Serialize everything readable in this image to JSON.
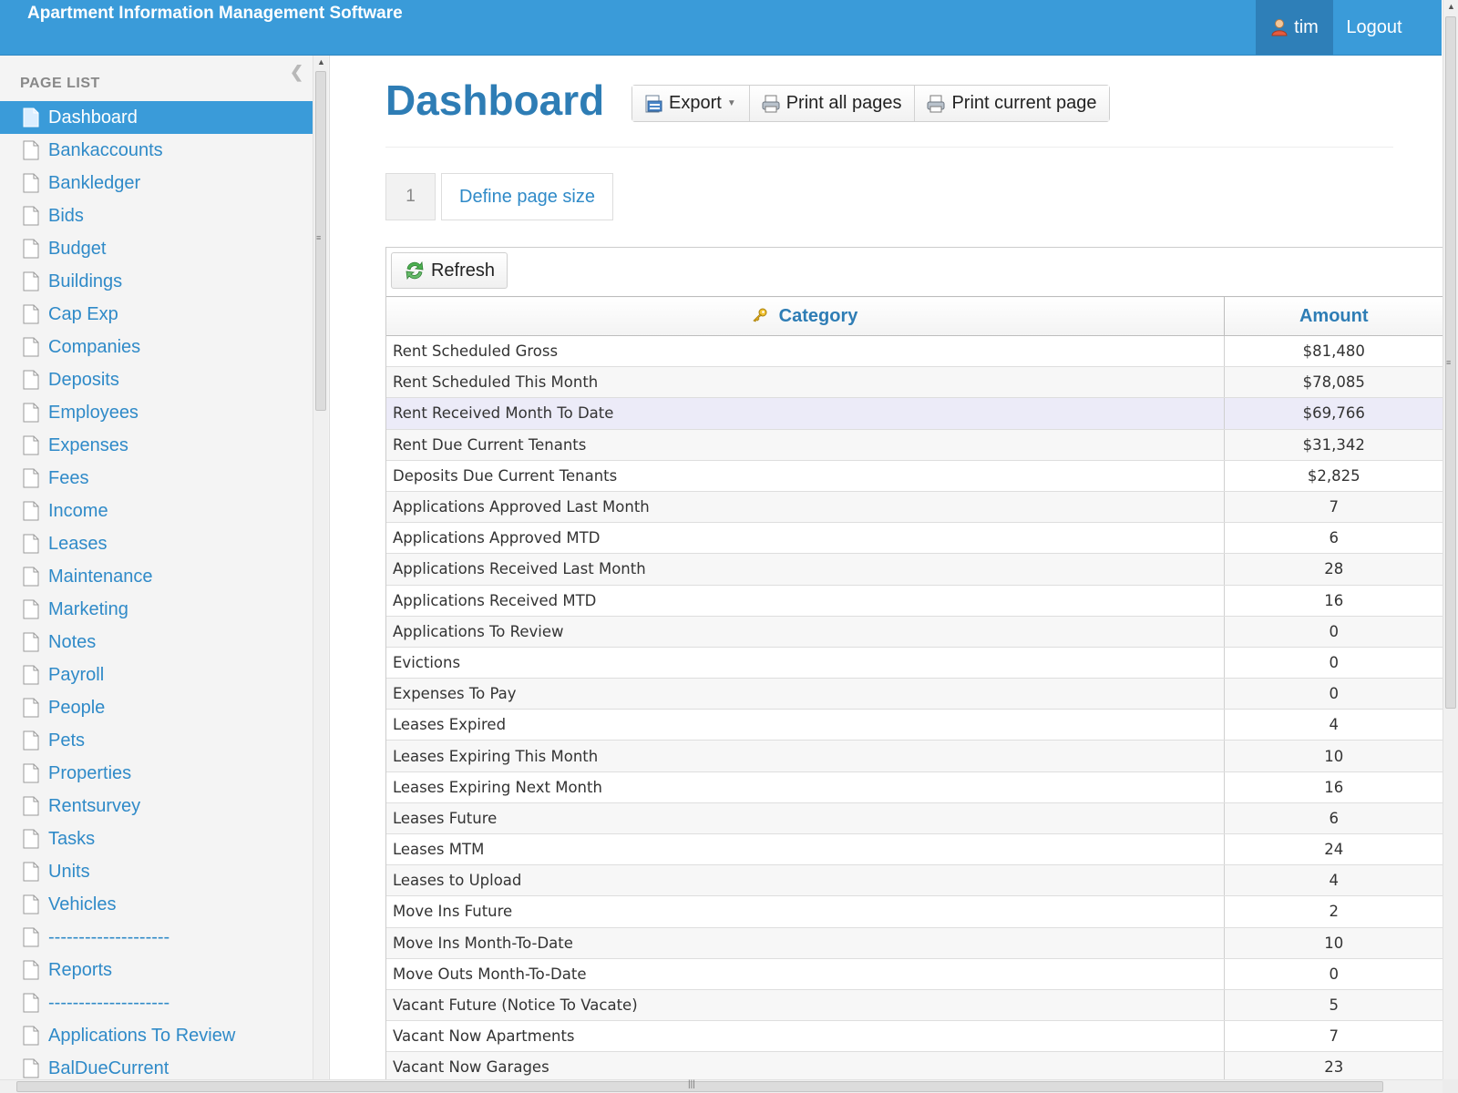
{
  "header": {
    "app_title": "Apartment Information Management Software",
    "username": "tim",
    "logout_label": "Logout",
    "bar_color": "#3a9bd9"
  },
  "sidebar": {
    "heading": "PAGE LIST",
    "active_index": 0,
    "items": [
      {
        "label": "Dashboard"
      },
      {
        "label": "Bankaccounts"
      },
      {
        "label": "Bankledger"
      },
      {
        "label": "Bids"
      },
      {
        "label": "Budget"
      },
      {
        "label": "Buildings"
      },
      {
        "label": "Cap Exp"
      },
      {
        "label": "Companies"
      },
      {
        "label": "Deposits"
      },
      {
        "label": "Employees"
      },
      {
        "label": "Expenses"
      },
      {
        "label": "Fees"
      },
      {
        "label": "Income"
      },
      {
        "label": "Leases"
      },
      {
        "label": "Maintenance"
      },
      {
        "label": "Marketing"
      },
      {
        "label": "Notes"
      },
      {
        "label": "Payroll"
      },
      {
        "label": "People"
      },
      {
        "label": "Pets"
      },
      {
        "label": "Properties"
      },
      {
        "label": "Rentsurvey"
      },
      {
        "label": "Tasks"
      },
      {
        "label": "Units"
      },
      {
        "label": "Vehicles"
      },
      {
        "label": "--------------------"
      },
      {
        "label": "Reports"
      },
      {
        "label": "--------------------"
      },
      {
        "label": "Applications To Review"
      },
      {
        "label": "BalDueCurrent"
      }
    ]
  },
  "main": {
    "page_title": "Dashboard",
    "toolbar": {
      "export_label": "Export",
      "print_all_label": "Print all pages",
      "print_current_label": "Print current page"
    },
    "pager": {
      "page_number": "1",
      "define_size_label": "Define page size"
    },
    "grid": {
      "refresh_label": "Refresh",
      "columns": [
        "Category",
        "Amount"
      ],
      "rows": [
        {
          "category": "Rent Scheduled Gross",
          "amount": "$81,480"
        },
        {
          "category": "Rent Scheduled This Month",
          "amount": "$78,085"
        },
        {
          "category": "Rent Received Month To Date",
          "amount": "$69,766"
        },
        {
          "category": "Rent Due Current Tenants",
          "amount": "$31,342"
        },
        {
          "category": "Deposits Due Current Tenants",
          "amount": "$2,825"
        },
        {
          "category": "Applications Approved Last Month",
          "amount": "7"
        },
        {
          "category": "Applications Approved MTD",
          "amount": "6"
        },
        {
          "category": "Applications Received Last Month",
          "amount": "28"
        },
        {
          "category": "Applications Received MTD",
          "amount": "16"
        },
        {
          "category": "Applications To Review",
          "amount": "0"
        },
        {
          "category": "Evictions",
          "amount": "0"
        },
        {
          "category": "Expenses To Pay",
          "amount": "0"
        },
        {
          "category": "Leases Expired",
          "amount": "4"
        },
        {
          "category": "Leases Expiring This Month",
          "amount": "10"
        },
        {
          "category": "Leases Expiring Next Month",
          "amount": "16"
        },
        {
          "category": "Leases Future",
          "amount": "6"
        },
        {
          "category": "Leases MTM",
          "amount": "24"
        },
        {
          "category": "Leases to Upload",
          "amount": "4"
        },
        {
          "category": "Move Ins Future",
          "amount": "2"
        },
        {
          "category": "Move Ins Month-To-Date",
          "amount": "10"
        },
        {
          "category": "Move Outs Month-To-Date",
          "amount": "0"
        },
        {
          "category": "Vacant Future (Notice To Vacate)",
          "amount": "5"
        },
        {
          "category": "Vacant Now Apartments",
          "amount": "7"
        },
        {
          "category": "Vacant Now Garages",
          "amount": "23"
        }
      ],
      "highlighted_row": 2,
      "highlight_color": "#ecebf8"
    }
  }
}
